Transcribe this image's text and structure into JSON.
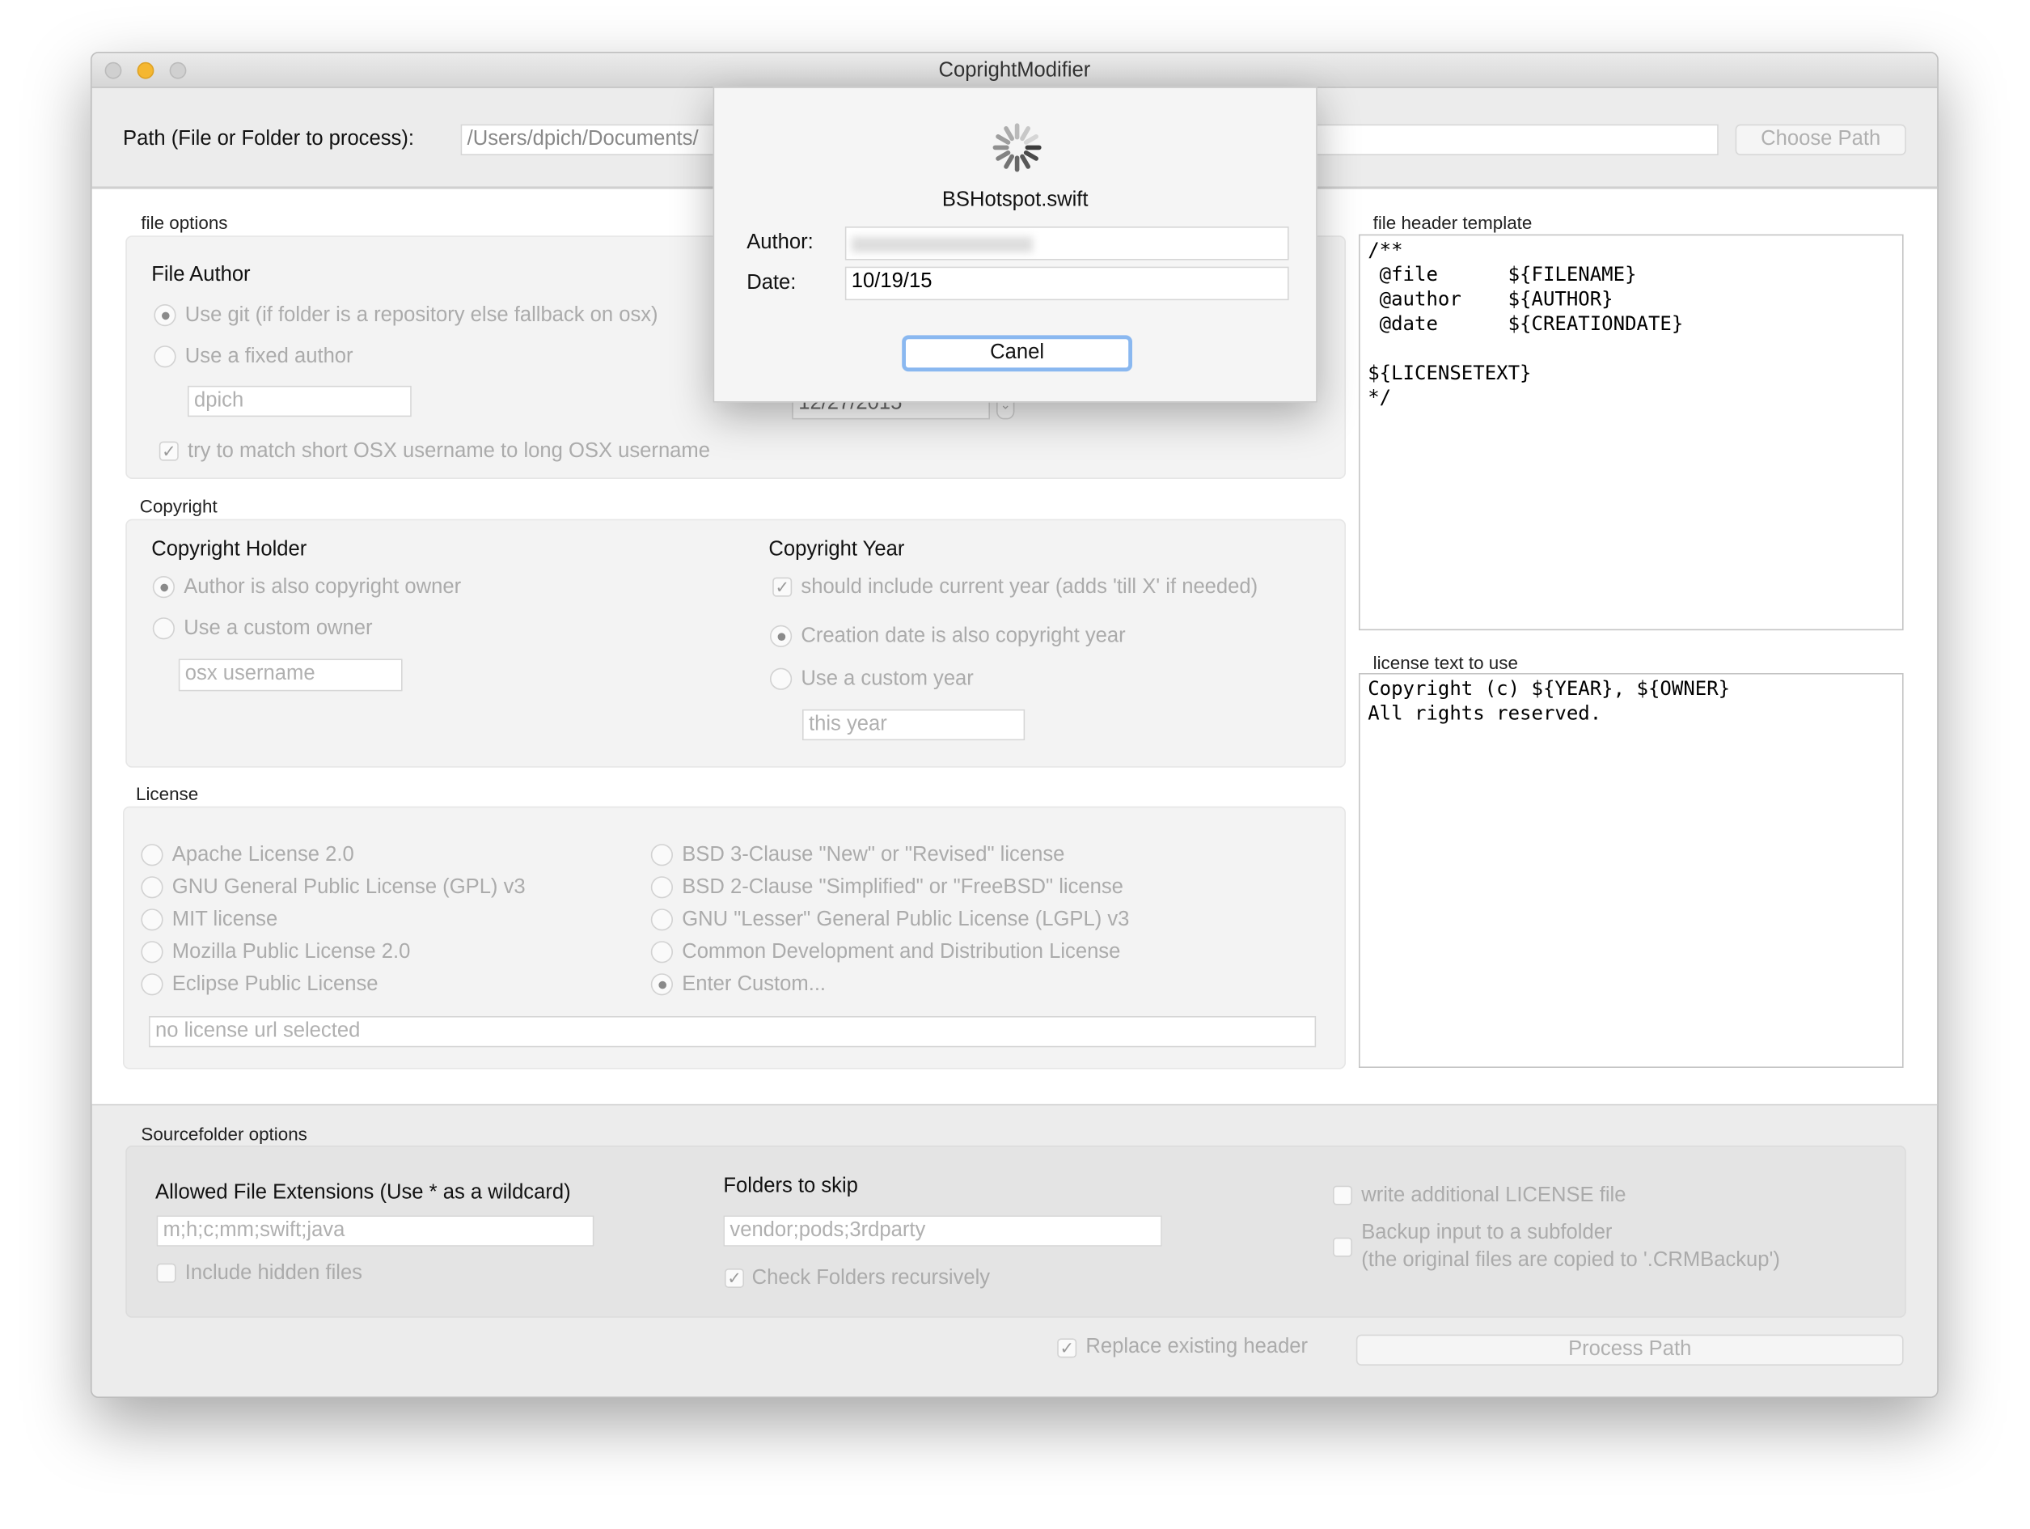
{
  "window": {
    "title": "CoprightModifier"
  },
  "path": {
    "label": "Path (File or Folder to process):",
    "value": "/Users/dpich/Documents/",
    "choose_button": "Choose Path"
  },
  "dialog": {
    "filename": "BSHotspot.swift",
    "author_label": "Author:",
    "author_value": "",
    "date_label": "Date:",
    "date_value": "10/19/15",
    "cancel_button": "Canel"
  },
  "file_options": {
    "title": "file options",
    "file_author": "File Author",
    "use_git": "Use git (if folder is a repository else fallback on osx)",
    "use_fixed": "Use a fixed author",
    "fixed_author_value": "dpich",
    "date_value": "12/27/2015",
    "match_username": "try to match short OSX username to long OSX username"
  },
  "copyright": {
    "title": "Copyright",
    "holder_heading": "Copyright Holder",
    "author_owner": "Author is also copyright owner",
    "custom_owner": "Use a custom owner",
    "owner_placeholder": "osx username",
    "year_heading": "Copyright Year",
    "include_current": "should include current year (adds 'till X' if needed)",
    "creation_year": "Creation date is also copyright year",
    "custom_year": "Use a custom year",
    "year_placeholder": "this year"
  },
  "license": {
    "title": "License",
    "options_left": [
      "Apache License 2.0",
      "GNU General Public License (GPL) v3",
      "MIT license",
      "Mozilla Public License 2.0",
      "Eclipse Public License"
    ],
    "options_right": [
      "BSD 3-Clause \"New\" or \"Revised\" license",
      "BSD 2-Clause \"Simplified\" or \"FreeBSD\" license",
      "GNU \"Lesser\" General Public License (LGPL) v3",
      "Common Development and Distribution License",
      "Enter Custom..."
    ],
    "selected": "Enter Custom...",
    "url_placeholder": "no license url selected"
  },
  "template": {
    "title": "file header template",
    "text": "/**\n @file      ${FILENAME}\n @author    ${AUTHOR}\n @date      ${CREATIONDATE}\n\n${LICENSETEXT}\n*/"
  },
  "license_text": {
    "title": "license text to use",
    "text": "Copyright (c) ${YEAR}, ${OWNER}\nAll rights reserved."
  },
  "sourcefolder": {
    "title": "Sourcefolder options",
    "extensions_heading": "Allowed File Extensions (Use * as a wildcard)",
    "extensions_placeholder": "m;h;c;mm;swift;java",
    "include_hidden": "Include hidden files",
    "skip_heading": "Folders to skip",
    "skip_placeholder": "vendor;pods;3rdparty",
    "recursive": "Check Folders recursively",
    "write_license": "write additional LICENSE file",
    "backup": "Backup input to a subfolder",
    "backup_note": "(the original files are copied to '.CRMBackup')"
  },
  "footer": {
    "replace_header": "Replace existing header",
    "process_button": "Process Path"
  }
}
